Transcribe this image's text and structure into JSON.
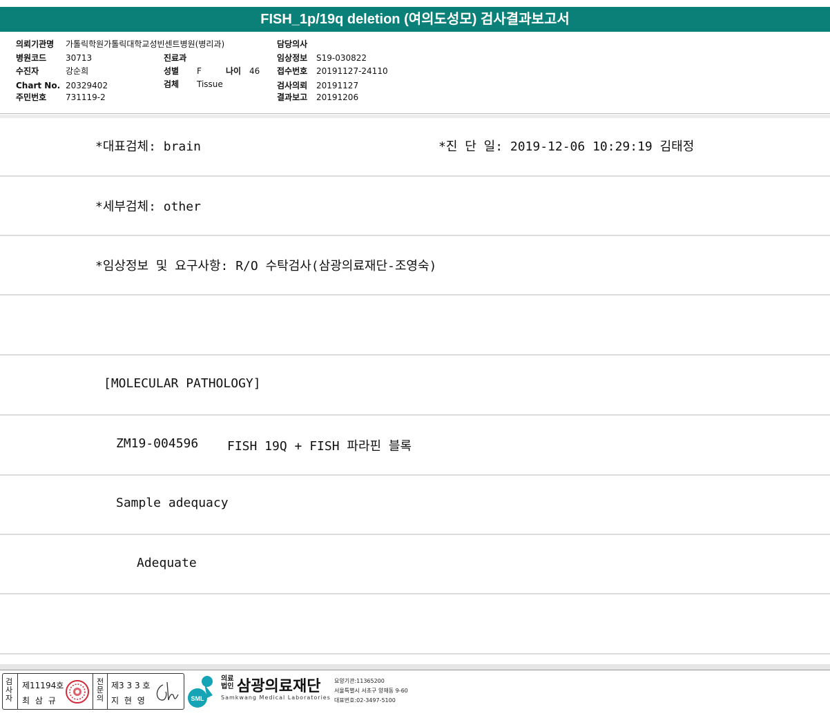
{
  "title": "FISH_1p/19q deletion (여의도성모) 검사결과보고서",
  "header": {
    "hospital_label": "의뢰기관명",
    "hospital_value": "가톨릭학원가톨릭대학교성빈센트병원(병리과)",
    "code_label": "병원코드",
    "code_value": "30713",
    "patient_label": "수진자",
    "patient_value": "강순희",
    "chart_label": "Chart No.",
    "chart_value": "20329402",
    "rrn_label": "주민번호",
    "rrn_value": "731119-2",
    "dept_label": "진료과",
    "dept_value": "",
    "sex_label": "성별",
    "sex_value": "F",
    "age_label": "나이",
    "age_value": "46",
    "specimen_label": "검체",
    "specimen_value": "Tissue",
    "doctor_label": "담당의사",
    "doctor_value": "",
    "clinical_label": "임상정보",
    "clinical_value": "S19-030822",
    "receipt_label": "접수번호",
    "receipt_value": "20191127-24110",
    "request_label": "검사의뢰",
    "request_value": "20191127",
    "report_label": "결과보고",
    "report_value": "20191206"
  },
  "report": {
    "main_specimen": "*대표검체: brain",
    "diag_date": "*진 단 일: 2019-12-06 10:29:19  김태정",
    "sub_specimen": "*세부검체: other",
    "clinical_info": "*임상정보 및 요구사항: R/O 수탁검사(삼광의료재단-조영숙)",
    "section": "[MOLECULAR PATHOLOGY]",
    "test_id": "ZM19-004596",
    "test_name": "FISH 19Q + FISH 파라핀 블록",
    "adequacy_label": "Sample adequacy",
    "adequacy_value": "Adequate"
  },
  "footer": {
    "tester_label": "검사자",
    "tester_no": "제11194호",
    "tester_name": "최 삼 규",
    "specialist_label": "전문의",
    "specialist_no": "제3 3 3 호",
    "specialist_name": "지 현 영",
    "org_prefix": "의료법인",
    "org_name": "삼광의료재단",
    "org_en": "Samkwang Medical Laboratories",
    "logo_text": "SML",
    "info1": "요양기관:11365200",
    "info2": "서울특별시 서초구 양재동 9-60",
    "info3": "대표번호:02-3497-5100"
  },
  "colors": {
    "title_bar": "#0b8079",
    "logo": "#15a3b6"
  }
}
